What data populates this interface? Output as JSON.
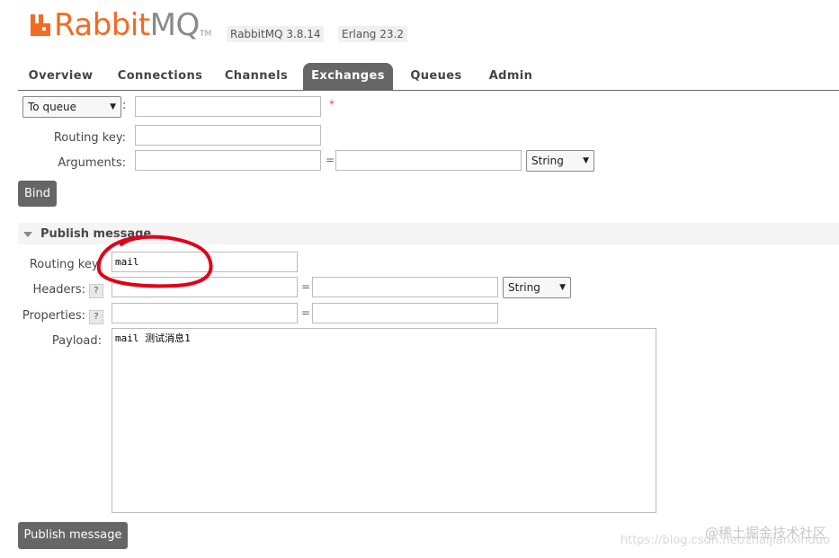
{
  "header": {
    "logo_rabbit": "Rabbit",
    "logo_mq": "MQ",
    "logo_tm": "TM",
    "rabbitmq_version": "RabbitMQ 3.8.14",
    "erlang_version": "Erlang 23.2"
  },
  "tabs": [
    {
      "label": "Overview",
      "active": false
    },
    {
      "label": "Connections",
      "active": false
    },
    {
      "label": "Channels",
      "active": false
    },
    {
      "label": "Exchanges",
      "active": true
    },
    {
      "label": "Queues",
      "active": false
    },
    {
      "label": "Admin",
      "active": false
    }
  ],
  "binding": {
    "destination_type": "To queue",
    "destination_value": "",
    "required_marker": "*",
    "routing_key_label": "Routing key:",
    "routing_key_value": "",
    "arguments_label": "Arguments:",
    "argument_key": "",
    "argument_value": "",
    "argument_type": "String",
    "bind_button": "Bind"
  },
  "publish": {
    "section_title": "Publish message",
    "routing_key_label": "Routing key:",
    "routing_key_value": "mail",
    "headers_label": "Headers:",
    "header_type": "String",
    "properties_label": "Properties:",
    "help_mark": "?",
    "payload_label": "Payload:",
    "payload_value": "mail 测试消息1",
    "publish_button": "Publish message"
  },
  "common": {
    "equals": "="
  },
  "watermark": {
    "text": "@稀土掘金技术社区",
    "url": "https://blog.csdn.net/zhaijianxinduo"
  },
  "colors": {
    "brand_orange": "#f26b22",
    "tab_active_bg": "#666666",
    "annotation_red": "#e0001a"
  }
}
